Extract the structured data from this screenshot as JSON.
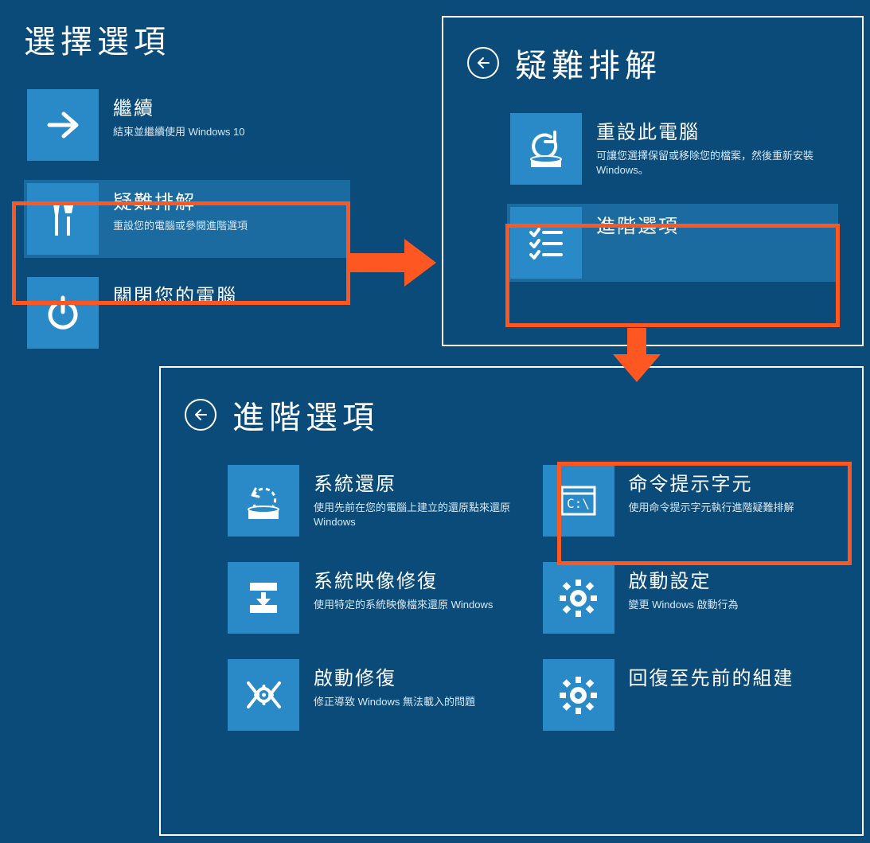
{
  "panel1": {
    "title": "選擇選項",
    "tiles": [
      {
        "title": "繼續",
        "desc": "結束並繼續使用 Windows 10"
      },
      {
        "title": "疑難排解",
        "desc": "重設您的電腦或參閱進階選項"
      },
      {
        "title": "關閉您的電腦",
        "desc": ""
      }
    ]
  },
  "panel2": {
    "title": "疑難排解",
    "tiles": [
      {
        "title": "重設此電腦",
        "desc": "可讓您選擇保留或移除您的檔案，然後重新安裝 Windows。"
      },
      {
        "title": "進階選項",
        "desc": ""
      }
    ]
  },
  "panel3": {
    "title": "進階選項",
    "tiles": [
      {
        "title": "系統還原",
        "desc": "使用先前在您的電腦上建立的還原點來還原 Windows"
      },
      {
        "title": "命令提示字元",
        "desc": "使用命令提示字元執行進階疑難排解"
      },
      {
        "title": "系統映像修復",
        "desc": "使用特定的系統映像檔來還原 Windows"
      },
      {
        "title": "啟動設定",
        "desc": "變更 Windows 啟動行為"
      },
      {
        "title": "啟動修復",
        "desc": "修正導致 Windows 無法載入的問題"
      },
      {
        "title": "回復至先前的組建",
        "desc": ""
      }
    ]
  }
}
